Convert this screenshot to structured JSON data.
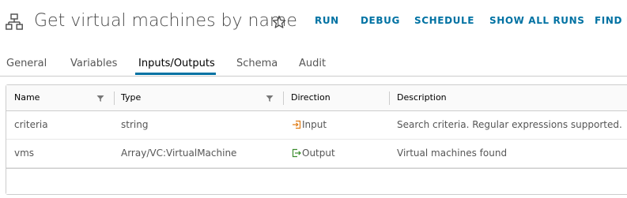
{
  "header": {
    "title": "Get virtual machines by name",
    "workflow_icon": "workflow-icon",
    "favorite_icon": "star-outline-icon",
    "actions": {
      "run": "RUN",
      "debug": "DEBUG",
      "schedule": "SCHEDULE",
      "show_all_runs": "SHOW ALL RUNS",
      "find": "FIND U"
    },
    "action_color": "#0072a3"
  },
  "tabs": {
    "items": [
      {
        "label": "General",
        "active": false
      },
      {
        "label": "Variables",
        "active": false
      },
      {
        "label": "Inputs/Outputs",
        "active": true
      },
      {
        "label": "Schema",
        "active": false
      },
      {
        "label": "Audit",
        "active": false
      }
    ],
    "active_color": "#0072a3"
  },
  "grid": {
    "columns": [
      {
        "label": "Name",
        "filterable": true
      },
      {
        "label": "Type",
        "filterable": true
      },
      {
        "label": "Direction",
        "filterable": false
      },
      {
        "label": "Description",
        "filterable": false
      }
    ],
    "rows": [
      {
        "name": "criteria",
        "type": "string",
        "direction": "Input",
        "direction_icon": "input-arrow-icon",
        "description": "Search criteria. Regular expressions supported."
      },
      {
        "name": "vms",
        "type": "Array/VC:VirtualMachine",
        "direction": "Output",
        "direction_icon": "output-arrow-icon",
        "description": "Virtual machines found"
      }
    ],
    "filter_icon": "filter-icon"
  }
}
